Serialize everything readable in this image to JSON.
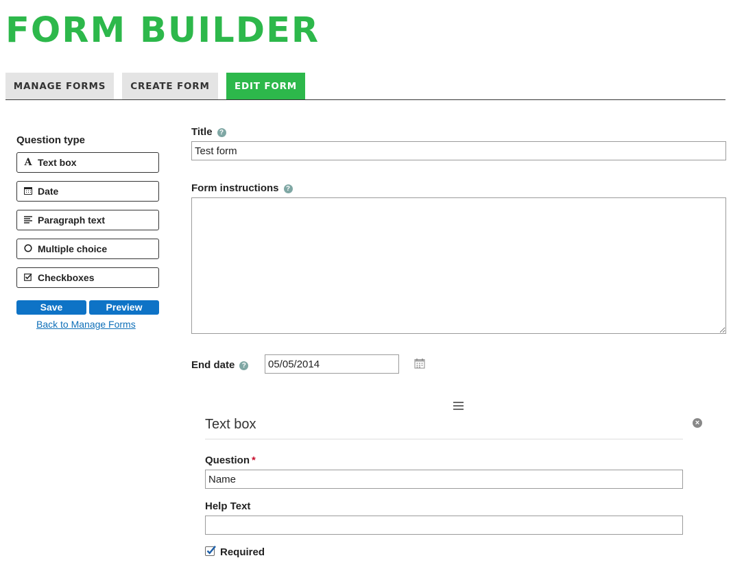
{
  "app": {
    "title": "FORM BUILDER"
  },
  "tabs": [
    {
      "label": "MANAGE FORMS",
      "active": false
    },
    {
      "label": "CREATE FORM",
      "active": false
    },
    {
      "label": "EDIT FORM",
      "active": true
    }
  ],
  "sidebar": {
    "heading": "Question type",
    "question_types": [
      {
        "label": "Text box",
        "icon": "text-a-icon"
      },
      {
        "label": "Date",
        "icon": "calendar-icon"
      },
      {
        "label": "Paragraph text",
        "icon": "paragraph-lines-icon"
      },
      {
        "label": "Multiple choice",
        "icon": "radio-circle-icon"
      },
      {
        "label": "Checkboxes",
        "icon": "checkbox-icon"
      }
    ],
    "save_label": "Save",
    "preview_label": "Preview",
    "back_link": "Back to Manage Forms"
  },
  "form": {
    "title_label": "Title",
    "title_value": "Test form",
    "instructions_label": "Form instructions",
    "instructions_value": "",
    "end_date_label": "End date",
    "end_date_value": "05/05/2014"
  },
  "question_card": {
    "type_title": "Text box",
    "question_label": "Question",
    "required_mark": "*",
    "question_value": "Name",
    "help_text_label": "Help Text",
    "help_text_value": "",
    "required_label": "Required",
    "required_checked": true
  },
  "colors": {
    "brand_green": "#2db84b",
    "button_blue": "#0e73c6",
    "link_blue": "#0e6fb8",
    "required_red": "#c8102e"
  }
}
